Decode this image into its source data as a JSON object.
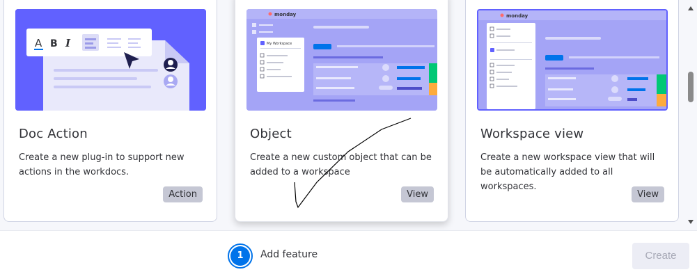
{
  "cards": [
    {
      "title": "Doc Action",
      "description": "Create a new plug-in to support new actions in the workdocs.",
      "tag": "Action",
      "thumb_icon": "doc-editor-illustration"
    },
    {
      "title": "Object",
      "description": "Create a new custom object that can be added to a workspace",
      "tag": "View",
      "thumb_icon": "monday-object-illustration",
      "thumb_brand": "monday",
      "thumb_workspace": "My Workspace"
    },
    {
      "title": "Workspace view",
      "description": "Create a new workspace view that will be automatically added to all workspaces.",
      "tag": "View",
      "thumb_icon": "monday-workspace-illustration",
      "thumb_brand": "monday"
    }
  ],
  "footer": {
    "step_number": "1",
    "step_label": "Add feature",
    "create_label": "Create"
  },
  "colors": {
    "accent": "#0073ea",
    "thumb_bg": "#6161ff",
    "tag_bg": "#c5c7d4"
  }
}
